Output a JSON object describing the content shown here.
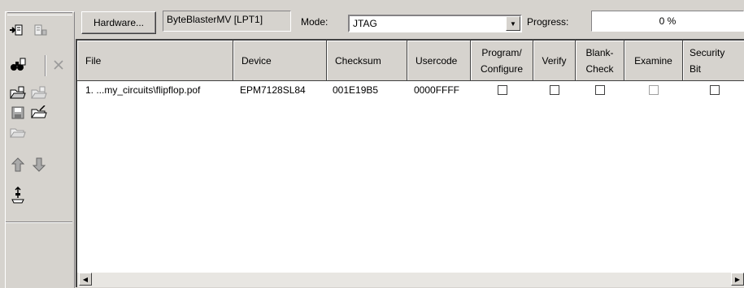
{
  "toolbar": {
    "buttons": [
      {
        "name": "start-icon",
        "icon": "start"
      },
      {
        "name": "stop-icon",
        "icon": "stop"
      },
      {
        "name": "auto-detect-icon",
        "icon": "binoculars"
      },
      {
        "name": "delete-icon",
        "icon": "x"
      },
      {
        "name": "add-file-icon",
        "icon": "folder"
      },
      {
        "name": "change-file-icon",
        "icon": "folder-gray"
      },
      {
        "name": "save-file-icon",
        "icon": "disk"
      },
      {
        "name": "add-device-icon",
        "icon": "folder-open"
      },
      {
        "name": "change-device-icon",
        "icon": "folder-gray-2"
      },
      {
        "name": "up-icon",
        "icon": "up"
      },
      {
        "name": "down-icon",
        "icon": "down"
      },
      {
        "name": "jtag-chain-icon",
        "icon": "chain"
      }
    ]
  },
  "header": {
    "hardware_button": "Hardware...",
    "hardware_value": "ByteBlasterMV [LPT1]",
    "mode_label": "Mode:",
    "mode_value": "JTAG",
    "progress_label": "Progress:",
    "progress_value": "0 %",
    "progress_fraction": 0
  },
  "table": {
    "columns": {
      "file": "File",
      "device": "Device",
      "checksum": "Checksum",
      "usercode": "Usercode",
      "program": [
        "Program/",
        "Configure"
      ],
      "verify": "Verify",
      "blank_check": [
        "Blank-",
        "Check"
      ],
      "examine": "Examine",
      "security": [
        "Security",
        "Bit"
      ]
    },
    "rows": [
      {
        "file": "1. ...my_circuits\\flipflop.pof",
        "device": "EPM7128SL84",
        "checksum": "001E19B5",
        "usercode": "0000FFFF",
        "program": false,
        "verify": false,
        "blank_check": false,
        "examine": false,
        "security": false
      }
    ]
  },
  "colors": {
    "face": "#d6d3ce",
    "shadow": "#848284",
    "dark": "#404040",
    "window": "#ffffff"
  }
}
